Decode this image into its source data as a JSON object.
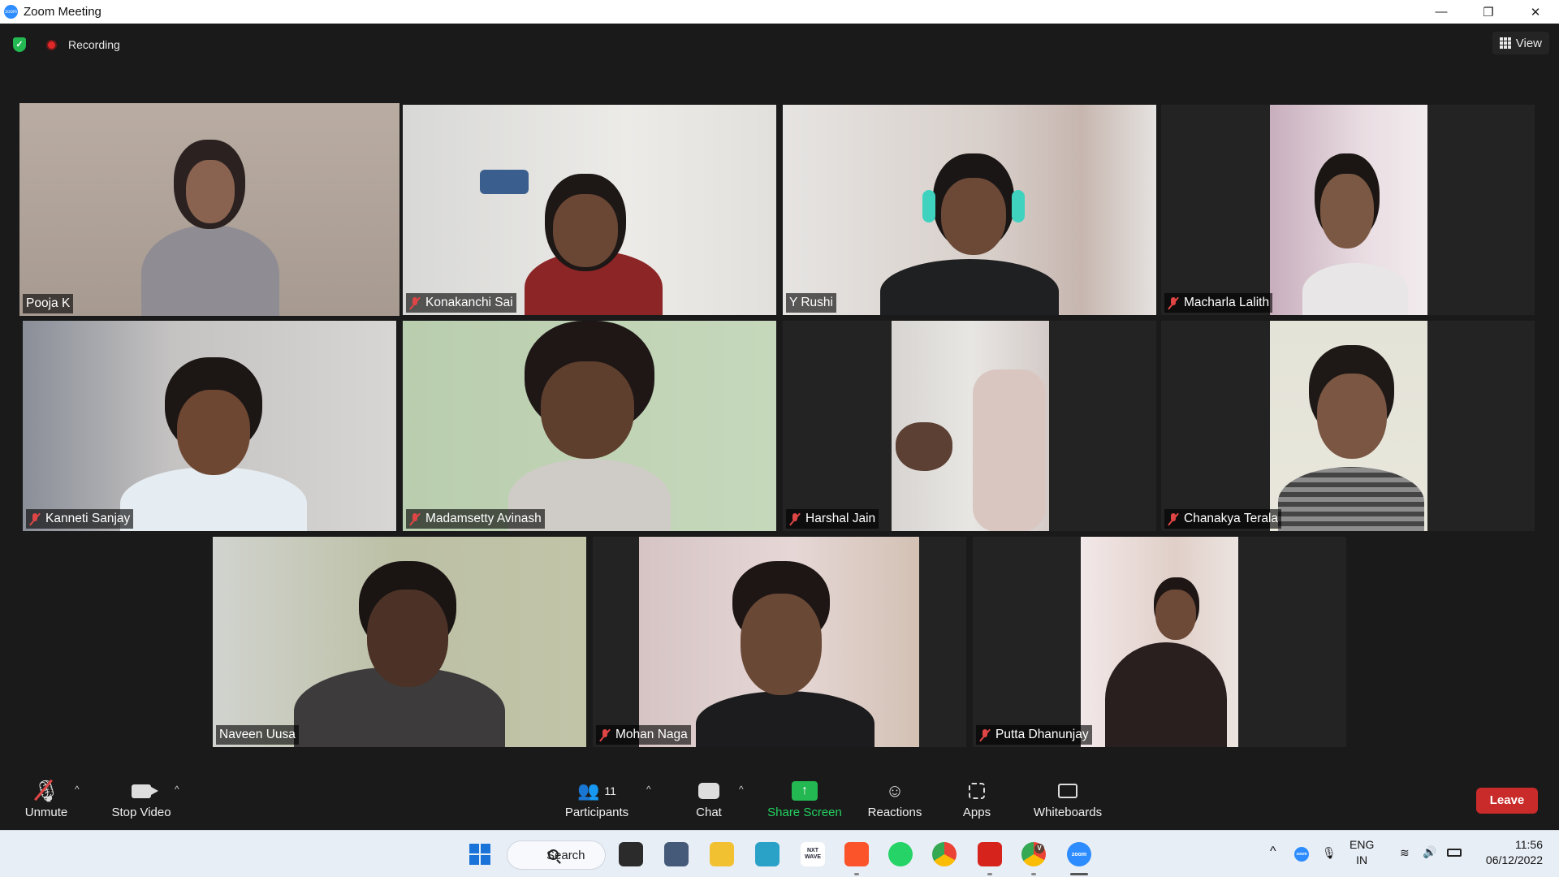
{
  "window": {
    "title": "Zoom Meeting",
    "app_icon_text": "zoom",
    "controls": {
      "minimize": "—",
      "restore": "❐",
      "close": "✕"
    }
  },
  "topbar": {
    "recording_label": "Recording",
    "view_label": "View"
  },
  "participants": [
    {
      "name": "Pooja K",
      "muted": false,
      "active_speaker": true
    },
    {
      "name": "Konakanchi Sai",
      "muted": true
    },
    {
      "name": "Y Rushi",
      "muted": false
    },
    {
      "name": "Macharla Lalith",
      "muted": true
    },
    {
      "name": "Kanneti Sanjay",
      "muted": true
    },
    {
      "name": "Madamsetty Avinash",
      "muted": true
    },
    {
      "name": "Harshal Jain",
      "muted": true
    },
    {
      "name": "Chanakya Terala",
      "muted": true
    },
    {
      "name": "Naveen Uusa",
      "muted": false
    },
    {
      "name": "Mohan Naga",
      "muted": true
    },
    {
      "name": "Putta Dhanunjay",
      "muted": true
    }
  ],
  "toolbar": {
    "unmute_label": "Unmute",
    "stop_video_label": "Stop Video",
    "participants_label": "Participants",
    "participants_count": "11",
    "chat_label": "Chat",
    "share_label": "Share Screen",
    "reactions_label": "Reactions",
    "apps_label": "Apps",
    "whiteboards_label": "Whiteboards",
    "leave_label": "Leave",
    "caret": "^"
  },
  "taskbar": {
    "search_label": "Search",
    "nxt_wave": "NXT WAVE",
    "language_line1": "ENG",
    "language_line2": "IN",
    "time": "11:56",
    "date": "06/12/2022",
    "chrome_badge": "V",
    "zoom_tray": "zoom"
  },
  "colors": {
    "active_speaker_border": "#d9ec6b",
    "leave": "#c92a2a",
    "share": "#23b852",
    "muted_icon": "#e04545"
  }
}
